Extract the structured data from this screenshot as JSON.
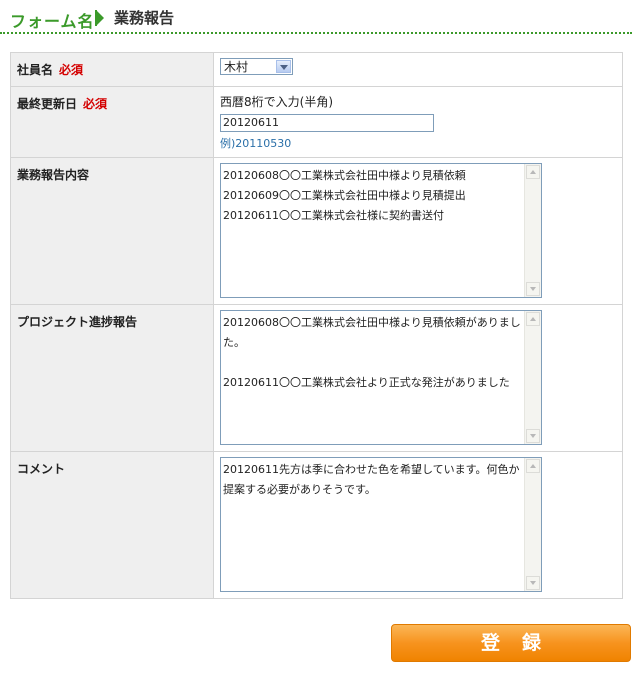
{
  "header": {
    "form_label": "フォーム名",
    "title": "業務報告"
  },
  "fields": {
    "employee": {
      "label": "社員名",
      "required": "必須",
      "selected": "木村"
    },
    "last_update": {
      "label": "最終更新日",
      "required": "必須",
      "note": "西暦8桁で入力(半角)",
      "value": "20120611",
      "example": "例)20110530"
    },
    "report": {
      "label": "業務報告内容",
      "value": "20120608〇〇工業株式会社田中様より見積依頼\n20120609〇〇工業株式会社田中様より見積提出\n20120611〇〇工業株式会社様に契約書送付"
    },
    "project": {
      "label": "プロジェクト進捗報告",
      "value": "20120608〇〇工業株式会社田中様より見積依頼がありました。\n\n20120611〇〇工業株式会社より正式な発注がありました"
    },
    "comment": {
      "label": "コメント",
      "value": "20120611先方は季に合わせた色を希望しています。何色か提案する必要がありそうです。"
    }
  },
  "submit": {
    "label": "登録"
  }
}
